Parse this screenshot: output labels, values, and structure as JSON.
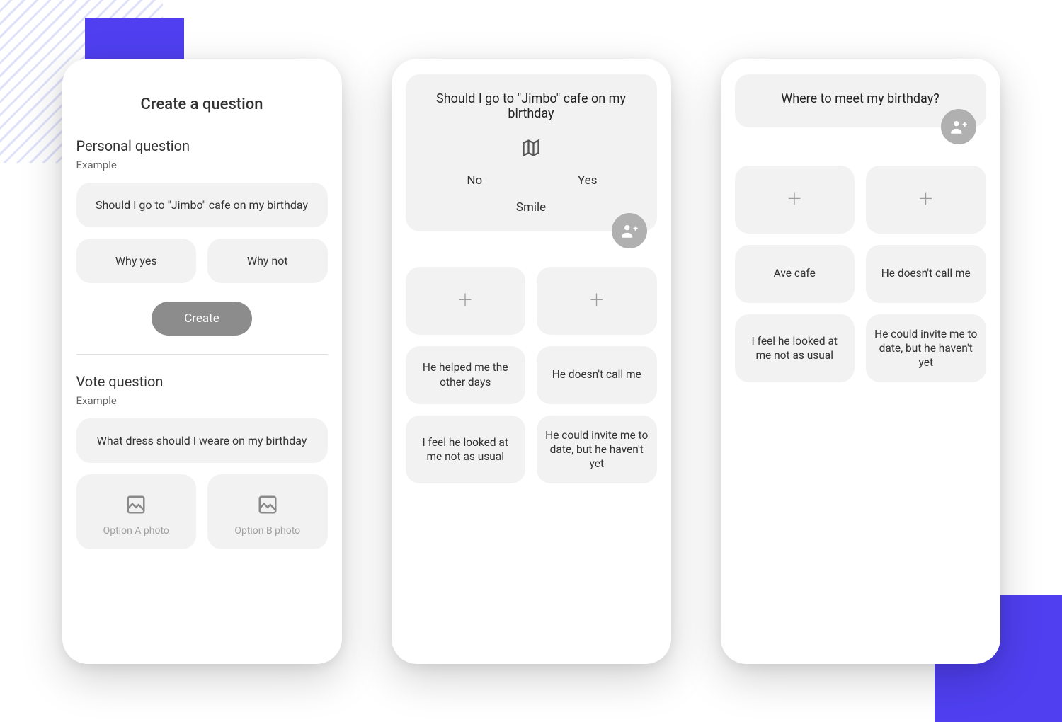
{
  "screen1": {
    "title": "Create a question",
    "personal": {
      "heading": "Personal question",
      "sub": "Example",
      "example_question": "Should I go to \"Jimbo\" cafe on my birthday",
      "option_a": "Why yes",
      "option_b": "Why not",
      "create_button": "Create"
    },
    "vote": {
      "heading": "Vote question",
      "sub": "Example",
      "example_question": "What dress should I weare on my birthday",
      "photo_a": "Option A photo",
      "photo_b": "Option B photo"
    }
  },
  "screen2": {
    "question": "Should I go to \"Jimbo\" cafe on my birthday",
    "vote_no": "No",
    "vote_yes": "Yes",
    "smile": "Smile",
    "cards": [
      "",
      "",
      "He helped me the other days",
      "He doesn't call me",
      "I feel he looked at me not as usual",
      "He could invite me to date, but he haven't yet"
    ]
  },
  "screen3": {
    "question": "Where to meet my birthday?",
    "cards": [
      "",
      "",
      "Ave cafe",
      "He doesn't call me",
      "I feel he looked at me not as usual",
      "He could invite me to date, but he haven't yet"
    ]
  },
  "icons": {
    "map": "map-icon",
    "image": "image-icon",
    "person_add": "person-add-icon",
    "plus": "plus-icon"
  },
  "colors": {
    "accent": "#4f3ff0",
    "panel": "#f2f2f2",
    "fab": "#b0b0b0",
    "button": "#8c8c8c"
  }
}
